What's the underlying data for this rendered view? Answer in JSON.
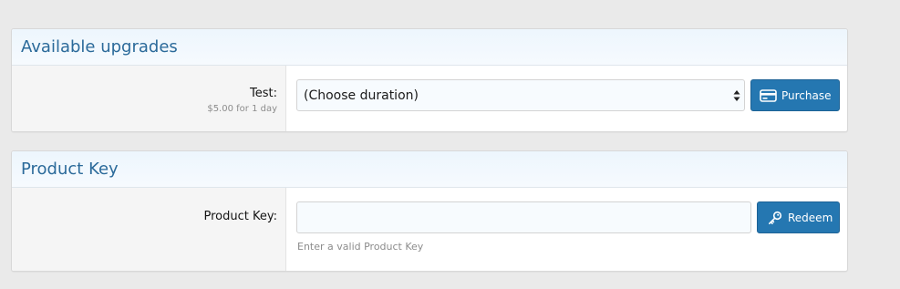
{
  "upgrades": {
    "title": "Available upgrades",
    "item": {
      "label": "Test:",
      "price": "$5.00 for 1 day",
      "duration_select_value": "(Choose duration)",
      "purchase_label": "Purchase"
    }
  },
  "product_key": {
    "title": "Product Key",
    "label": "Product Key:",
    "input_value": "",
    "hint": "Enter a valid Product Key",
    "redeem_label": "Redeem"
  },
  "icons": {
    "purchase": "credit-card-icon",
    "redeem": "key-icon",
    "select": "sort-arrows-icon"
  },
  "colors": {
    "button": "#2577b1",
    "header_text": "#2b6a9a",
    "page_background": "#eaeaea"
  }
}
